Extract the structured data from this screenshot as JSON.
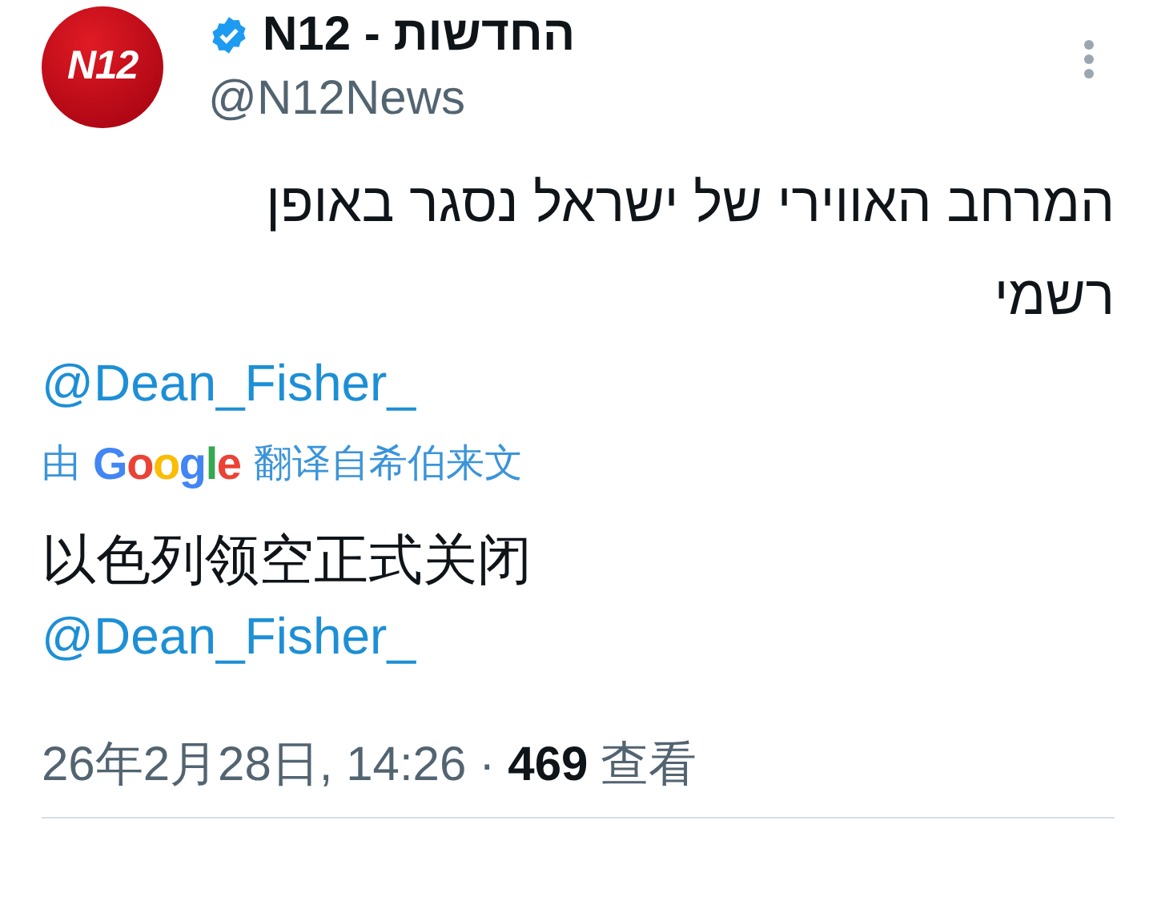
{
  "author": {
    "avatar_text": "N12",
    "name": "החדשות - N12",
    "verified": true,
    "handle": "@N12News"
  },
  "tweet": {
    "text": "המרחב האווירי של ישראל נסגר באופן רשמי",
    "mention": "@Dean_Fisher_"
  },
  "translation": {
    "prefix": "由",
    "brand": "Google",
    "suffix": "翻译自希伯来文",
    "text": "以色列领空正式关闭",
    "mention": "@Dean_Fisher_"
  },
  "meta": {
    "date": "26年2月28日, 14:26",
    "separator": "·",
    "views": "469",
    "views_label": "查看"
  }
}
